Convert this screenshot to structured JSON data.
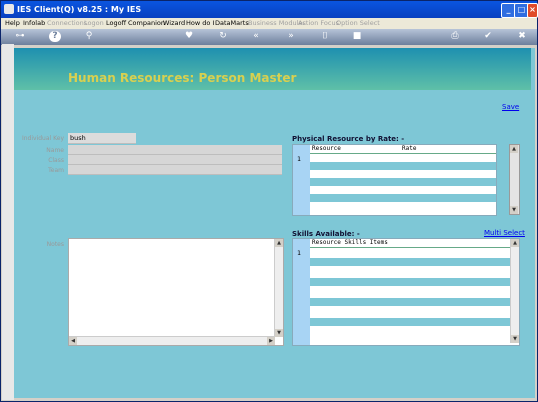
{
  "window": {
    "title": "IES Client(Q) v8.25 : My IES"
  },
  "menu": [
    {
      "label": "Help",
      "enabled": true
    },
    {
      "label": "Infolab",
      "enabled": true
    },
    {
      "label": "Connections",
      "enabled": false
    },
    {
      "label": "Logon",
      "enabled": false
    },
    {
      "label": "Logoff",
      "enabled": true
    },
    {
      "label": "Companion",
      "enabled": true
    },
    {
      "label": "Wizard",
      "enabled": true
    },
    {
      "label": "How do I",
      "enabled": true
    },
    {
      "label": "DataMarts",
      "enabled": true
    },
    {
      "label": "Business Modules",
      "enabled": false
    },
    {
      "label": "Action Focus",
      "enabled": false
    },
    {
      "label": "Option Select",
      "enabled": false
    }
  ],
  "toolbar_icons": [
    "key-icon",
    "help-icon",
    "search-icon",
    "heart-icon",
    "refresh-icon",
    "back-icon",
    "forward-icon",
    "trash-icon",
    "stop-icon",
    "print-icon",
    "check-icon",
    "close-icon"
  ],
  "header": {
    "title": "Human Resources: Person Master"
  },
  "actions": {
    "save": "Save",
    "multi_select": "Multi Select"
  },
  "fields": {
    "individual_key": {
      "label": "Individual Key",
      "value": "bush"
    },
    "name": {
      "label": "Name",
      "value": ""
    },
    "class": {
      "label": "Class",
      "value": ""
    },
    "team": {
      "label": "Team",
      "value": ""
    },
    "notes": {
      "label": "Notes",
      "value": ""
    }
  },
  "physical_resource": {
    "title": "Physical Resource by Rate: -",
    "columns": [
      "Resource",
      "Rate"
    ],
    "first_row_number": "1"
  },
  "skills": {
    "title": "Skills Available: -",
    "columns": [
      "Resource Skills Items"
    ],
    "first_row_number": "1"
  }
}
